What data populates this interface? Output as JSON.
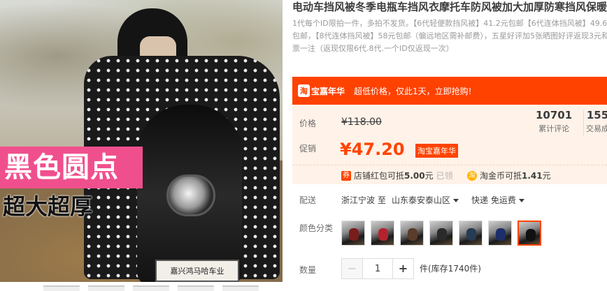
{
  "gallery": {
    "overlay_label": "黑色圆点",
    "overlay_sub": "超大超厚",
    "plate_text": "嘉兴鸿马哈车业"
  },
  "product": {
    "title": "电动车挡风被冬季电瓶车挡风衣摩托车防风被加大加厚防寒挡风保暖",
    "subtitle": "1代每个ID限拍一件，多拍不发货。【6代轻便款挡风被】41.2元包邮【6代连体挡风被】49.6元包邮，【8代连体挡风被】58元包邮（偏远地区需补邮费），五星好评加5张晒图好评返现3元和彩票一注（返现仅限6代.8代.一个ID仅返现一次）"
  },
  "promo": {
    "logo_mark": "淘",
    "logo_text": "宝嘉年华",
    "text": "超低价格，仅此1天，立即抢购!"
  },
  "price": {
    "label": "价格",
    "original": "¥118.00",
    "sale_label": "促销",
    "sale": "¥47.20",
    "sale_badge": "淘宝嘉年华",
    "reviews_count": "10701",
    "reviews_label": "累计评论",
    "sales_count": "155",
    "sales_label": "交易成"
  },
  "coupons": {
    "redpacket_icon": "券",
    "redpacket_text": "店铺红包可抵",
    "redpacket_amount": "5.00",
    "redpacket_unit": "元",
    "redpacket_status": "已领",
    "coin_icon": "淘",
    "coin_text": "淘金币可抵",
    "coin_amount": "1.41",
    "coin_unit": "元"
  },
  "shipping": {
    "label": "配送",
    "from": "浙江宁波",
    "to_word": "至",
    "destination": "山东泰安泰山区",
    "method": "快递 免运费"
  },
  "colors": {
    "label": "颜色分类",
    "options": 7,
    "selected_index": 7
  },
  "quantity": {
    "label": "数量",
    "value": "1",
    "dec": "−",
    "inc": "+",
    "stock": "件(库存1740件)"
  },
  "theme": {
    "accent": "#ff4400",
    "promo_bg": "#ff4200",
    "price_bg": "#fff2e8",
    "label_pink": "#f04f8d"
  }
}
